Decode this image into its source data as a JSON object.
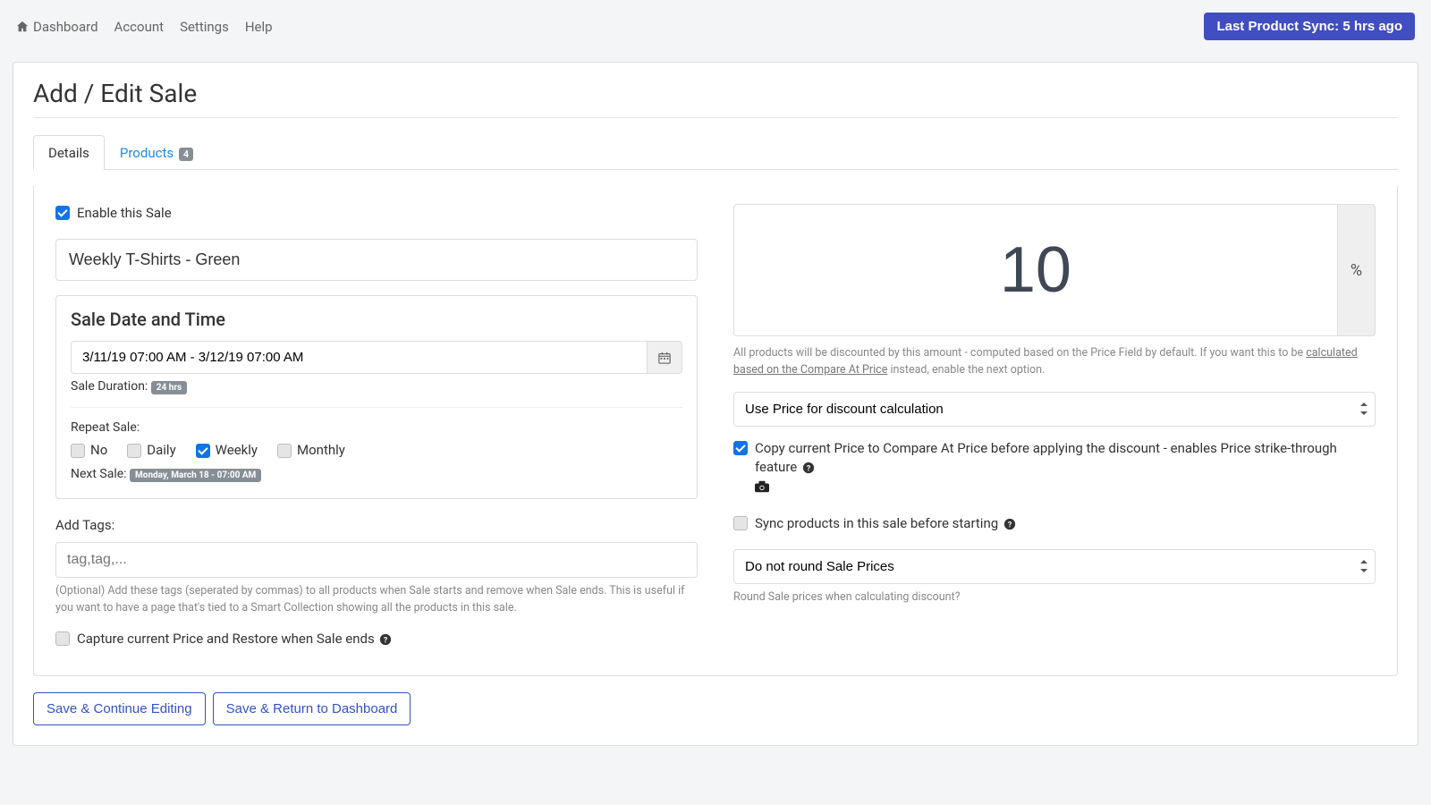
{
  "topbar": {
    "dashboard": "Dashboard",
    "account": "Account",
    "settings": "Settings",
    "help": "Help",
    "sync_button": "Last Product Sync: 5 hrs ago"
  },
  "page": {
    "title": "Add / Edit Sale"
  },
  "tabs": {
    "details": "Details",
    "products": "Products",
    "products_count": "4"
  },
  "left": {
    "enable_label": "Enable this Sale",
    "sale_name": "Weekly T-Shirts - Green",
    "date_panel_title": "Sale Date and Time",
    "date_range": "3/11/19 07:00 AM - 3/12/19 07:00 AM",
    "duration_label": "Sale Duration:",
    "duration_badge": "24 hrs",
    "repeat_label": "Repeat Sale:",
    "repeat": {
      "no": "No",
      "daily": "Daily",
      "weekly": "Weekly",
      "monthly": "Monthly"
    },
    "next_sale_label": "Next Sale:",
    "next_sale_badge": "Monday, March 18 - 07:00 AM",
    "tags_label": "Add Tags:",
    "tags_placeholder": "tag,tag,...",
    "tags_help": "(Optional) Add these tags (seperated by commas) to all products when Sale starts and remove when Sale ends. This is useful if you want to have a page that's tied to a Smart Collection showing all the products in this sale.",
    "capture_label": "Capture current Price and Restore when Sale ends"
  },
  "right": {
    "discount_value": "10",
    "discount_unit": "%",
    "discount_help_pre": "All products will be discounted by this amount - computed based on the Price Field by default. If you want this to be ",
    "discount_help_link": "calculated based on the Compare At Price",
    "discount_help_post": " instead, enable the next option.",
    "price_calc_select": "Use Price for discount calculation",
    "copy_price_label": "Copy current Price to Compare At Price before applying the discount - enables Price strike-through feature",
    "sync_label": "Sync products in this sale before starting",
    "rounding_select": "Do not round Sale Prices",
    "rounding_help": "Round Sale prices when calculating discount?"
  },
  "footer": {
    "save_continue": "Save & Continue Editing",
    "save_return": "Save & Return to Dashboard"
  }
}
